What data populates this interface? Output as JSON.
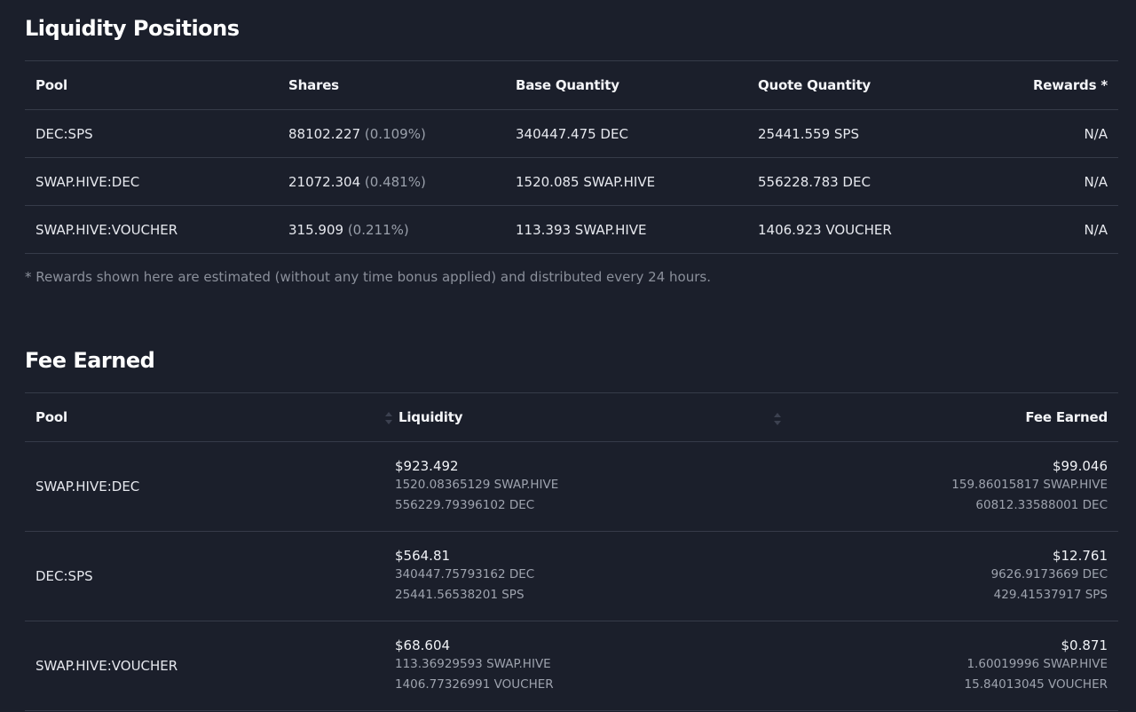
{
  "liquidity_positions": {
    "title": "Liquidity Positions",
    "columns": {
      "pool": "Pool",
      "shares": "Shares",
      "base": "Base Quantity",
      "quote": "Quote Quantity",
      "rewards": "Rewards *"
    },
    "rows": [
      {
        "pool": "DEC:SPS",
        "shares": "88102.227",
        "share_pct": "(0.109%)",
        "base": "340447.475 DEC",
        "quote": "25441.559 SPS",
        "rewards": "N/A"
      },
      {
        "pool": "SWAP.HIVE:DEC",
        "shares": "21072.304",
        "share_pct": "(0.481%)",
        "base": "1520.085 SWAP.HIVE",
        "quote": "556228.783 DEC",
        "rewards": "N/A"
      },
      {
        "pool": "SWAP.HIVE:VOUCHER",
        "shares": "315.909",
        "share_pct": "(0.211%)",
        "base": "113.393 SWAP.HIVE",
        "quote": "1406.923 VOUCHER",
        "rewards": "N/A"
      }
    ],
    "footnote": "* Rewards shown here are estimated (without any time bonus applied) and distributed every 24 hours."
  },
  "fee_earned": {
    "title": "Fee Earned",
    "columns": {
      "pool": "Pool",
      "liquidity": "Liquidity",
      "fee": "Fee Earned"
    },
    "rows": [
      {
        "pool": "SWAP.HIVE:DEC",
        "liquidity_usd": "$923.492",
        "liquidity_a": "1520.08365129 SWAP.HIVE",
        "liquidity_b": "556229.79396102 DEC",
        "fee_usd": "$99.046",
        "fee_a": "159.86015817 SWAP.HIVE",
        "fee_b": "60812.33588001 DEC"
      },
      {
        "pool": "DEC:SPS",
        "liquidity_usd": "$564.81",
        "liquidity_a": "340447.75793162 DEC",
        "liquidity_b": "25441.56538201 SPS",
        "fee_usd": "$12.761",
        "fee_a": "9626.9173669 DEC",
        "fee_b": "429.41537917 SPS"
      },
      {
        "pool": "SWAP.HIVE:VOUCHER",
        "liquidity_usd": "$68.604",
        "liquidity_a": "113.36929593 SWAP.HIVE",
        "liquidity_b": "1406.77326991 VOUCHER",
        "fee_usd": "$0.871",
        "fee_a": "1.60019996 SWAP.HIVE",
        "fee_b": "15.84013045 VOUCHER"
      }
    ]
  },
  "icons": {
    "sort": "sort-icon"
  }
}
